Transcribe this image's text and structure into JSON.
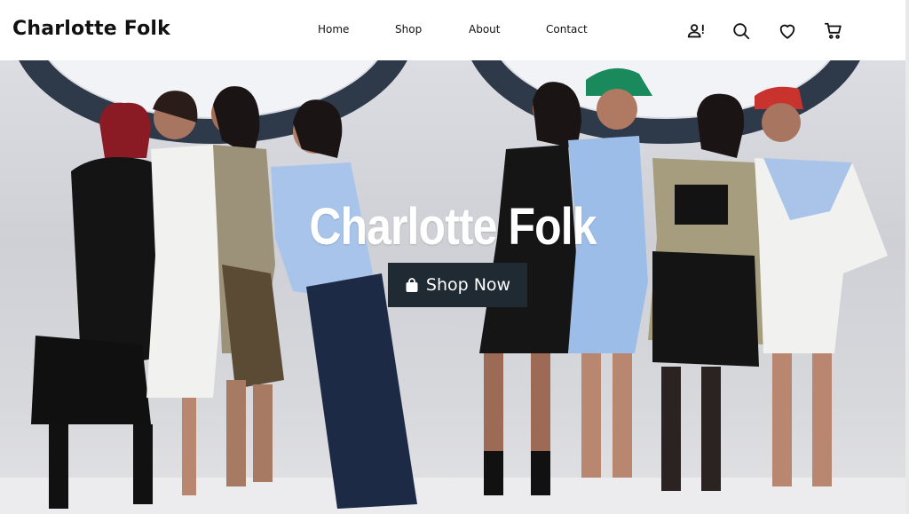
{
  "header": {
    "brand": "Charlotte Folk",
    "nav": [
      {
        "label": "Home"
      },
      {
        "label": "Shop"
      },
      {
        "label": "About"
      },
      {
        "label": "Contact"
      }
    ],
    "icons": [
      "user-alert-icon",
      "search-icon",
      "heart-icon",
      "cart-icon"
    ]
  },
  "hero": {
    "title": "Charlotte Folk",
    "cta_label": "Shop Now",
    "cta_icon": "shopping-bag-icon"
  },
  "colors": {
    "header_bg": "#ffffff",
    "text": "#111111",
    "cta_bg": "#1f2a33",
    "hero_text": "#ffffff",
    "backdrop": "#d6d7dc"
  }
}
